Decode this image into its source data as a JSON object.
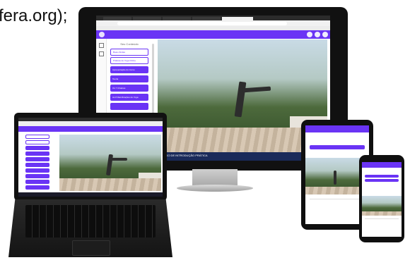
{
  "caption": "fera.org);",
  "monitor": {
    "sidebar": {
      "heading": "Seu Conteúdo",
      "items": [
        {
          "label": "Boas-Vindas",
          "style": "light"
        },
        {
          "label": "Práticas de Yoga Online",
          "style": "light"
        },
        {
          "label": "Apresentação do Curso",
          "style": "solid"
        },
        {
          "label": "Teoria",
          "style": "solid"
        },
        {
          "label": "Os 7 Chakras",
          "style": "solid"
        },
        {
          "label": "As 8 Ramificações do Yoga",
          "style": "solid"
        }
      ]
    },
    "video_footer": "CURSO DE INTRODUÇÃO PRÁTICA"
  },
  "colors": {
    "accent": "#6a34f5",
    "chrome": "#2b2b2b",
    "bezel": "#111111"
  }
}
